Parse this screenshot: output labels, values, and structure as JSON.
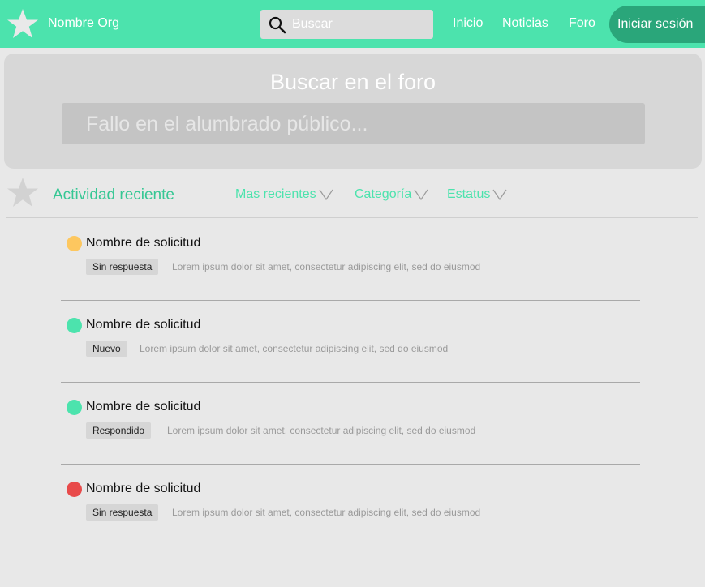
{
  "header": {
    "org_name": "Nombre Org",
    "search_placeholder": "Buscar",
    "nav": [
      "Inicio",
      "Noticias",
      "Foro"
    ],
    "login_label": "Iniciar sesión"
  },
  "hero": {
    "title": "Buscar en el foro",
    "search_placeholder": "Fallo en el alumbrado público..."
  },
  "activity": {
    "title": "Actividad reciente",
    "filters": [
      "Mas recientes",
      "Categoría",
      "Estatus"
    ]
  },
  "requests": [
    {
      "name": "Nombre de solicitud",
      "status": "Sin respuesta",
      "status_color": "#fdc75f",
      "description": "Lorem ipsum dolor sit amet, consectetur adipiscing elit, sed do eiusmod"
    },
    {
      "name": "Nombre de solicitud",
      "status": "Nuevo",
      "status_color": "#4ce3ad",
      "description": "Lorem ipsum dolor sit amet, consectetur adipiscing elit, sed do eiusmod"
    },
    {
      "name": "Nombre de solicitud",
      "status": "Respondido",
      "status_color": "#4ce3ad",
      "description": "Lorem ipsum dolor sit amet, consectetur adipiscing elit, sed do eiusmod"
    },
    {
      "name": "Nombre de solicitud",
      "status": "Sin respuesta",
      "status_color": "#e84a4a",
      "description": "Lorem ipsum dolor sit amet, consectetur adipiscing elit, sed do eiusmod"
    }
  ],
  "colors": {
    "brand": "#4ce3ad",
    "brand_dark": "#2aa67a",
    "accent_text": "#36c794"
  }
}
